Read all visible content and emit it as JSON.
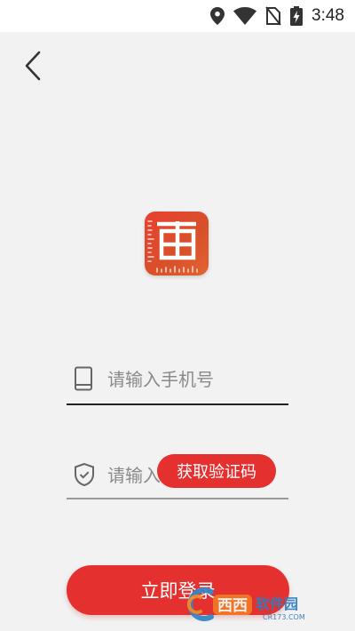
{
  "status_bar": {
    "time": "3:48",
    "icons": [
      "location-icon",
      "wifi-icon",
      "no-sim-icon",
      "battery-charging-icon"
    ]
  },
  "nav": {
    "back_icon": "chevron-left-icon"
  },
  "logo": {
    "icon": "app-logo-icon"
  },
  "form": {
    "phone": {
      "placeholder": "请输入手机号",
      "value": "",
      "icon": "phone-icon"
    },
    "code": {
      "placeholder": "请输入验证码",
      "value": "",
      "icon": "shield-check-icon"
    },
    "get_code_label": "获取验证码",
    "login_label": "立即登录"
  },
  "watermark": {
    "text": "西西软件园",
    "sub": "CR173.COM"
  },
  "colors": {
    "accent": "#e53030",
    "background": "#f2f2f2",
    "logo": "#e2472f"
  }
}
